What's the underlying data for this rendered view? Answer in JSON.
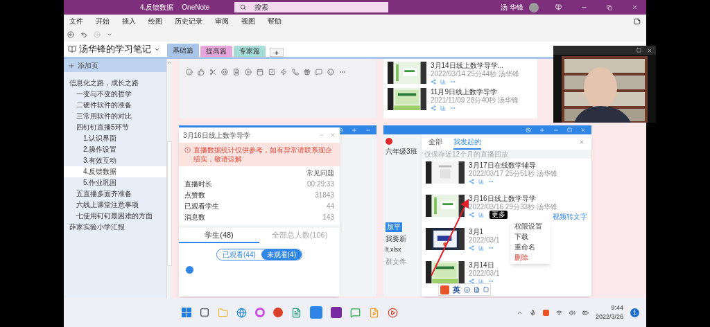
{
  "window": {
    "title": "4.反馈数据",
    "app": "OneNote",
    "search_placeholder": "搜索",
    "user": "汤 华锋"
  },
  "menu": [
    "文件",
    "开始",
    "插入",
    "绘图",
    "历史记录",
    "审阅",
    "视图",
    "帮助"
  ],
  "notebook": {
    "name": "汤华锋的学习笔记",
    "sections": [
      {
        "label": "基础篇",
        "selected": true,
        "color": "#a9c6ea"
      },
      {
        "label": "提高篇",
        "selected": false,
        "color": "#e9a6dc"
      },
      {
        "label": "专家篇",
        "selected": false,
        "color": "#a6dcd8"
      }
    ],
    "add": "+"
  },
  "pages": {
    "add_label": "添加页",
    "items": [
      {
        "label": "信息化之路，成长之路",
        "selected": false,
        "children": [
          {
            "label": "一变与不变的哲学",
            "selected": false
          },
          {
            "label": "二硬件软件的准备",
            "selected": false
          },
          {
            "label": "三常用软件的对比",
            "selected": false
          },
          {
            "label": "四钉钉直播5环节",
            "selected": false,
            "children": [
              {
                "label": "1.认识界面",
                "selected": false
              },
              {
                "label": "2.操作设置",
                "selected": false
              },
              {
                "label": "3.有效互动",
                "selected": false
              },
              {
                "label": "4.反馈数据",
                "selected": true
              },
              {
                "label": "5.作业巩固",
                "selected": false
              }
            ]
          },
          {
            "label": "五直播多面齐准备",
            "selected": false
          },
          {
            "label": "六线上课堂注意事项",
            "selected": false
          },
          {
            "label": "七使用钉钉最困难的方面",
            "selected": false
          }
        ]
      },
      {
        "label": "薛家实验小学汇报",
        "selected": false
      }
    ]
  },
  "top_list": [
    {
      "title": "3月14日线上数学导学...",
      "meta": "2022/03/14 25分44秒 汤华锋"
    },
    {
      "title": "11月9日线上数学导学",
      "meta": "2021/11/09 28分40秒 汤华锋"
    }
  ],
  "stats_dialog": {
    "title": "3月16日线上数学导学",
    "notice": "直播数据统计仅供参考，如有异常请联系现企绩实，敬请谅解",
    "help": "常见问题",
    "rows": [
      {
        "label": "直播时长",
        "value": "00:29:33"
      },
      {
        "label": "点赞数",
        "value": "31843"
      },
      {
        "label": "已观看学生",
        "value": "44"
      },
      {
        "label": "消息数",
        "value": "143"
      }
    ],
    "tabs": [
      {
        "label": "学生(48)",
        "selected": true
      },
      {
        "label": "全部总人数(106)",
        "selected": false
      }
    ],
    "filters": [
      {
        "label": "已观看(44)",
        "selected": false
      },
      {
        "label": "未观看(4)",
        "selected": true
      }
    ]
  },
  "chat": {
    "group": "六年级3班",
    "avatar": "加平",
    "message": "我要新",
    "file": "lt.xlsx",
    "files_label": "群文件"
  },
  "replay_panel": {
    "tabs": [
      {
        "label": "全部",
        "selected": false
      },
      {
        "label": "我发起的",
        "selected": true
      }
    ],
    "hint": "仅保存近12个月的直播回放",
    "items": [
      {
        "title": "3月17日在线数学辅导",
        "meta": "2022/03/17 25分51秒 汤华锋"
      },
      {
        "title": "3月16日线上数学导学",
        "meta": "2022/03/16 29分33秒 汤华锋"
      },
      {
        "title": "3月1",
        "meta": "2022/03/1"
      },
      {
        "title": "3月14日",
        "meta": "2022/03/1"
      }
    ],
    "tooltip": "更多",
    "transcribe": "视频转文字",
    "menu": [
      {
        "label": "权限设置",
        "danger": false
      },
      {
        "label": "下载",
        "danger": false
      },
      {
        "label": "重命名",
        "danger": false
      },
      {
        "label": "删除",
        "danger": true
      }
    ]
  },
  "ime": {
    "mode": "英"
  },
  "taskbar": {
    "time": "9:44",
    "date": "2022/3/26",
    "notifications": "1"
  }
}
